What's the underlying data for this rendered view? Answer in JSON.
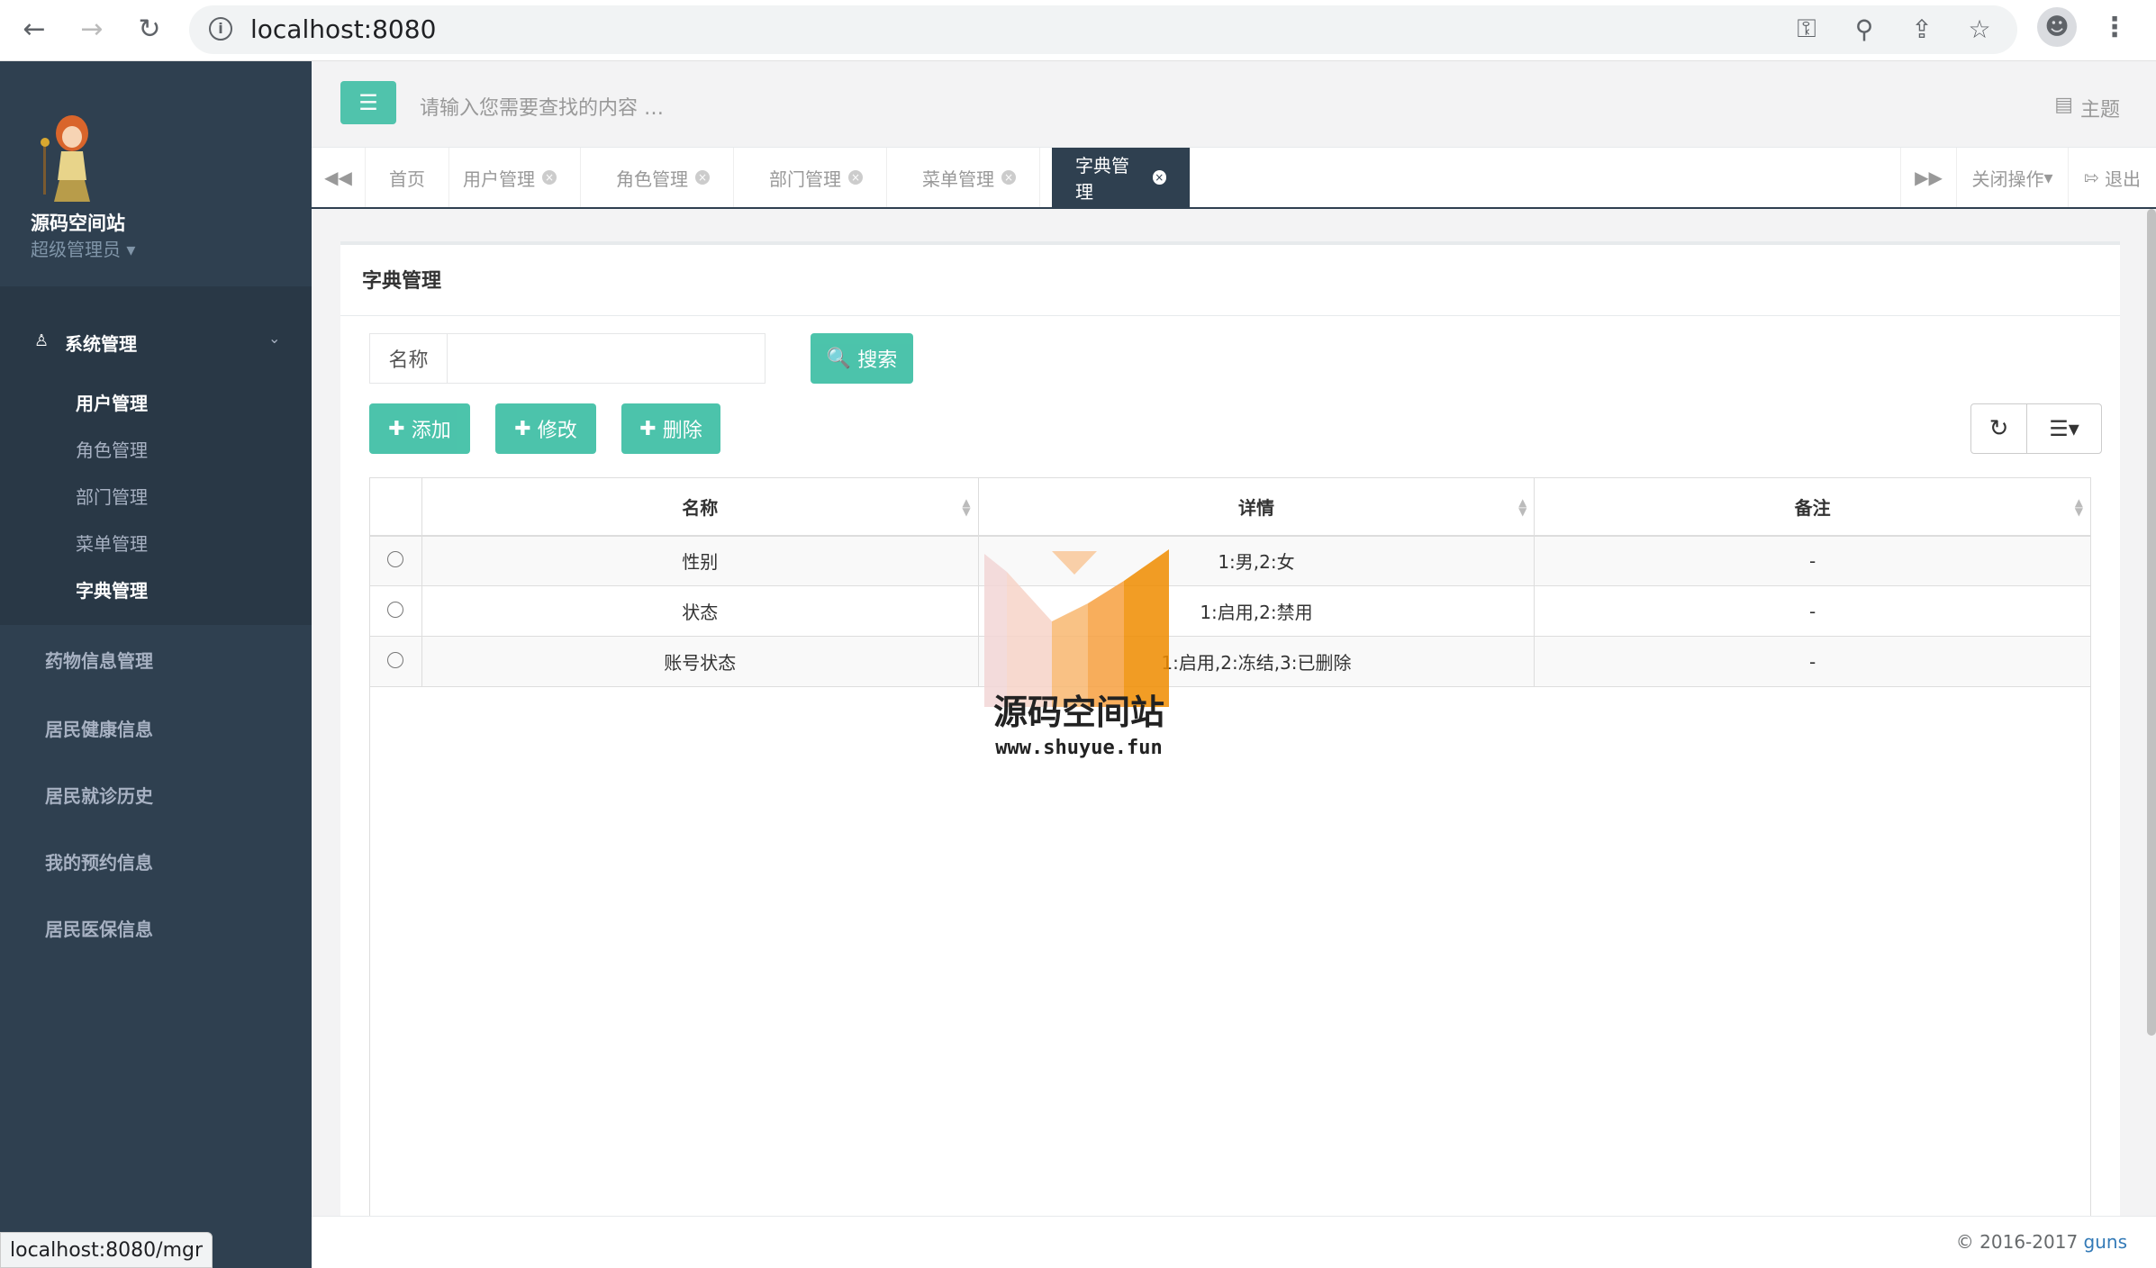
{
  "browser": {
    "url": "localhost:8080",
    "status_url": "localhost:8080/mgr"
  },
  "sidebar": {
    "site_name": "源码空间站",
    "role": "超级管理员",
    "group": {
      "label": "系统管理",
      "items": [
        {
          "label": "用户管理",
          "active": false
        },
        {
          "label": "角色管理",
          "active": false
        },
        {
          "label": "部门管理",
          "active": false
        },
        {
          "label": "菜单管理",
          "active": false
        },
        {
          "label": "字典管理",
          "active": true
        }
      ]
    },
    "items": [
      {
        "label": "药物信息管理"
      },
      {
        "label": "居民健康信息"
      },
      {
        "label": "居民就诊历史"
      },
      {
        "label": "我的预约信息"
      },
      {
        "label": "居民医保信息"
      }
    ]
  },
  "header": {
    "search_placeholder": "请输入您需要查找的内容 …",
    "theme": "主题"
  },
  "tabs": {
    "items": [
      {
        "label": "首页",
        "closable": false,
        "active": false
      },
      {
        "label": "用户管理",
        "closable": true,
        "active": false
      },
      {
        "label": "角色管理",
        "closable": true,
        "active": false
      },
      {
        "label": "部门管理",
        "closable": true,
        "active": false
      },
      {
        "label": "菜单管理",
        "closable": true,
        "active": false
      },
      {
        "label": "字典管理",
        "closable": true,
        "active": true
      }
    ],
    "close_ops": "关闭操作",
    "logout": "退出"
  },
  "panel": {
    "title": "字典管理",
    "search_label": "名称",
    "search_value": "",
    "search_button": "搜索",
    "add_button": "添加",
    "edit_button": "修改",
    "delete_button": "删除"
  },
  "table": {
    "columns": [
      "名称",
      "详情",
      "备注"
    ],
    "rows": [
      [
        "性别",
        "1:男,2:女",
        "-"
      ],
      [
        "状态",
        "1:启用,2:禁用",
        "-"
      ],
      [
        "账号状态",
        "1:启用,2:冻结,3:已删除",
        "-"
      ]
    ]
  },
  "watermark": {
    "title": "源码空间站",
    "url": "www.shuyue.fun"
  },
  "footer": {
    "copyright": "© 2016-2017",
    "link": "guns"
  },
  "colors": {
    "sidebar_bg": "#2f4050",
    "accent": "#1ab394",
    "watermark_orange": "#f08c00"
  }
}
